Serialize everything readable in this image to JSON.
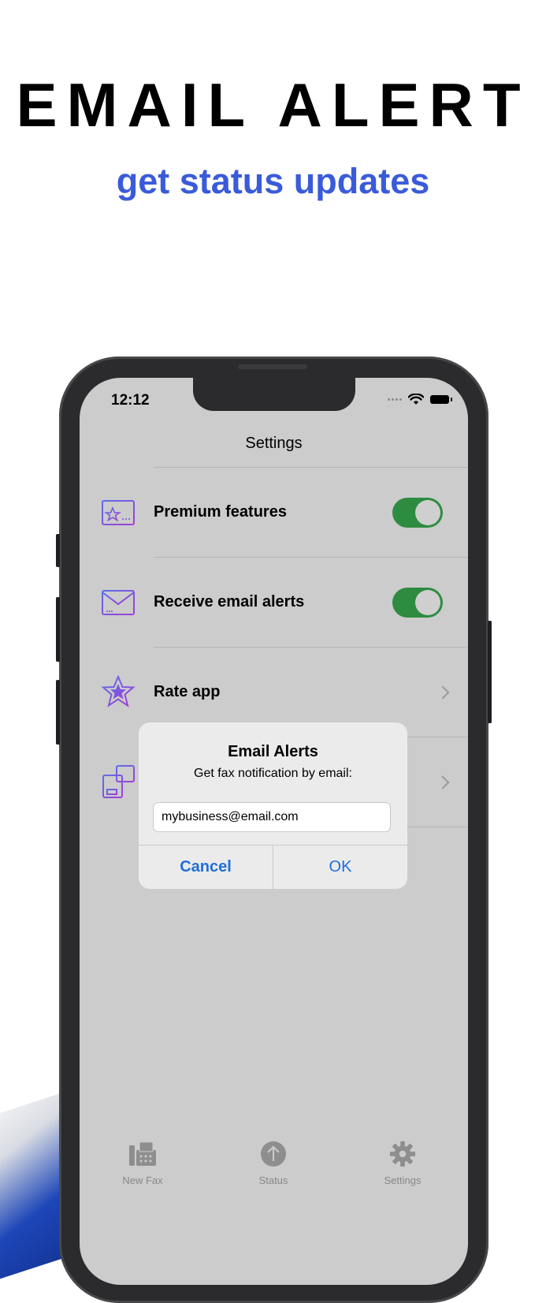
{
  "promo": {
    "headline": "EMAIL ALERT",
    "subheadline": "get status updates"
  },
  "status_bar": {
    "time": "12:12"
  },
  "screen": {
    "title": "Settings"
  },
  "settings_rows": [
    {
      "label": "Premium features",
      "control": "toggle",
      "on": true
    },
    {
      "label": "Receive email alerts",
      "control": "toggle",
      "on": true
    },
    {
      "label": "Rate app",
      "control": "chevron"
    },
    {
      "label": "",
      "control": "chevron"
    }
  ],
  "alert": {
    "title": "Email Alerts",
    "message": "Get fax notification by email:",
    "input_value": "mybusiness@email.com",
    "cancel_label": "Cancel",
    "ok_label": "OK"
  },
  "tab_bar": {
    "tabs": [
      {
        "label": "New Fax",
        "icon": "fax-icon"
      },
      {
        "label": "Status",
        "icon": "upload-status-icon"
      },
      {
        "label": "Settings",
        "icon": "gear-icon"
      }
    ]
  },
  "colors": {
    "subheadline": "#3a5bd9",
    "toggle_on": "#2e8c40",
    "alert_button": "#1f6fd8",
    "icon_gradient_start": "#5b6ee8",
    "icon_gradient_end": "#a23ed6"
  }
}
